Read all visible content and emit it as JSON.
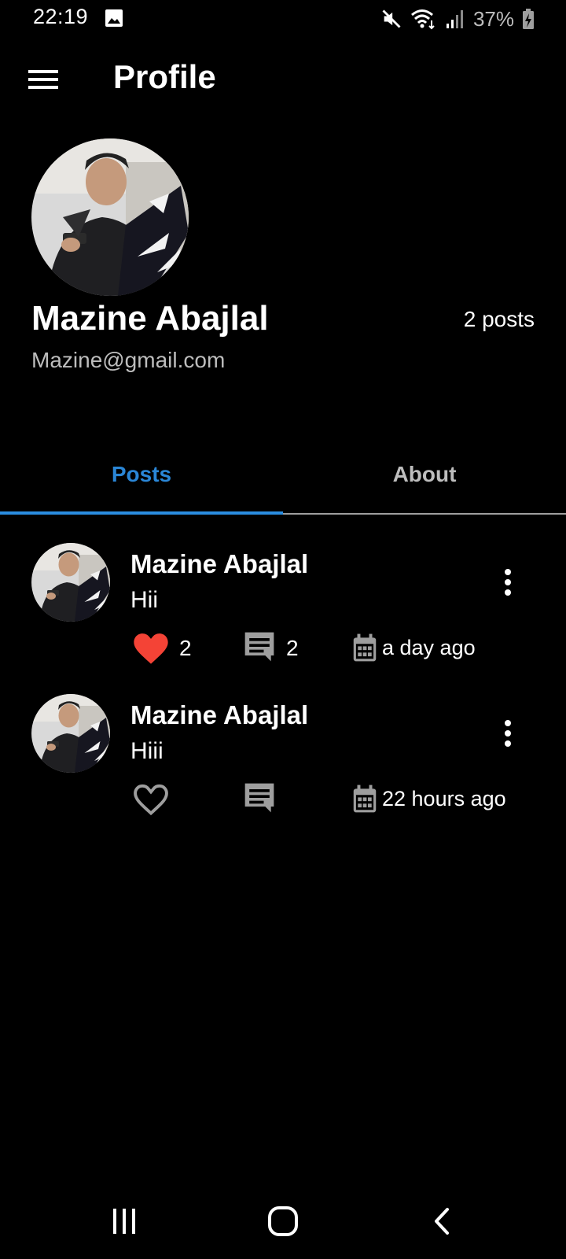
{
  "status_bar": {
    "time": "22:19",
    "battery": "37%",
    "icons": [
      "gallery-icon",
      "mute-icon",
      "wifi-icon",
      "signal-icon",
      "battery-charging-icon"
    ]
  },
  "app_bar": {
    "title": "Profile",
    "menu_icon": "hamburger-menu-icon"
  },
  "profile": {
    "name": "Mazine Abajlal",
    "email": "Mazine@gmail.com",
    "posts_count": "2 posts"
  },
  "tabs": [
    {
      "label": "Posts",
      "active": true
    },
    {
      "label": "About",
      "active": false
    }
  ],
  "posts": [
    {
      "author": "Mazine Abajlal",
      "text": "Hii",
      "liked": true,
      "likes": "2",
      "comments": "2",
      "date": "a day ago"
    },
    {
      "author": "Mazine Abajlal",
      "text": "Hiii",
      "liked": false,
      "likes": "",
      "comments": "",
      "date": "22 hours ago"
    }
  ],
  "colors": {
    "background": "#000000",
    "accent": "#2a86d6",
    "like": "#f44336",
    "muted": "#9e9e9e"
  },
  "nav_bar": {
    "icons": [
      "recent-apps-icon",
      "home-icon",
      "back-icon"
    ]
  }
}
